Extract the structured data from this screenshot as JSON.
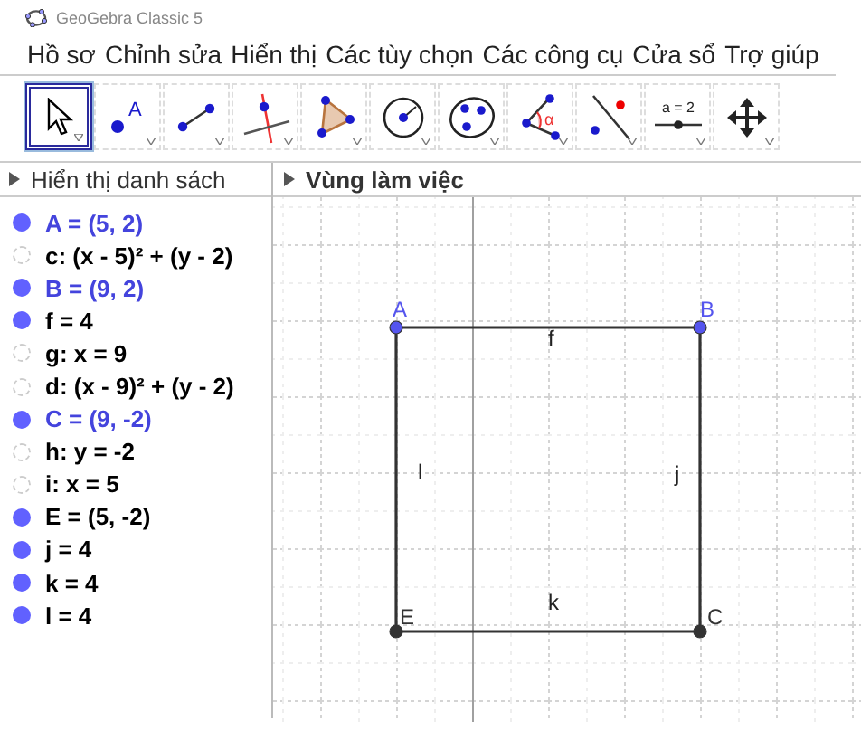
{
  "window": {
    "title": "GeoGebra Classic 5"
  },
  "menu": [
    "Hồ sơ",
    "Chỉnh sửa",
    "Hiển thị",
    "Các tùy chọn",
    "Các công cụ",
    "Cửa sổ",
    "Trợ giúp"
  ],
  "tools": [
    {
      "kind": "move",
      "selected": true
    },
    {
      "kind": "point",
      "label": "A",
      "selected": false
    },
    {
      "kind": "segment",
      "selected": false
    },
    {
      "kind": "perpendicular",
      "selected": false
    },
    {
      "kind": "polygon",
      "selected": false
    },
    {
      "kind": "circle",
      "selected": false
    },
    {
      "kind": "conic",
      "selected": false
    },
    {
      "kind": "angle",
      "label": "α",
      "selected": false
    },
    {
      "kind": "reflect",
      "selected": false
    },
    {
      "kind": "slider",
      "label": "a = 2",
      "selected": false
    },
    {
      "kind": "move-view",
      "selected": false
    }
  ],
  "algebra": {
    "title": "Hiển thị danh sách",
    "items": [
      {
        "text": "A = (5, 2)",
        "visible": true,
        "color": "#4444dd"
      },
      {
        "text": "c: (x - 5)² + (y - 2)",
        "visible": false,
        "color": "#000000"
      },
      {
        "text": "B = (9, 2)",
        "visible": true,
        "color": "#4444dd"
      },
      {
        "text": "f = 4",
        "visible": true,
        "color": "#000000"
      },
      {
        "text": "g: x = 9",
        "visible": false,
        "color": "#000000"
      },
      {
        "text": "d: (x - 9)² + (y - 2)",
        "visible": false,
        "color": "#000000"
      },
      {
        "text": "C = (9, -2)",
        "visible": true,
        "color": "#4444dd"
      },
      {
        "text": "h: y = -2",
        "visible": false,
        "color": "#000000"
      },
      {
        "text": "i: x = 5",
        "visible": false,
        "color": "#000000"
      },
      {
        "text": "E = (5, -2)",
        "visible": true,
        "color": "#000000"
      },
      {
        "text": "j = 4",
        "visible": true,
        "color": "#000000"
      },
      {
        "text": "k = 4",
        "visible": true,
        "color": "#000000"
      },
      {
        "text": "l = 4",
        "visible": true,
        "color": "#000000"
      }
    ]
  },
  "graphics": {
    "title": "Vùng làm việc",
    "points": [
      {
        "label": "A",
        "color": "#5555ee"
      },
      {
        "label": "B",
        "color": "#5555ee"
      },
      {
        "label": "E",
        "color": "#333333"
      },
      {
        "label": "C",
        "color": "#333333"
      }
    ],
    "segments": [
      {
        "label": "f"
      },
      {
        "label": "j"
      },
      {
        "label": "k"
      },
      {
        "label": "l"
      }
    ]
  }
}
